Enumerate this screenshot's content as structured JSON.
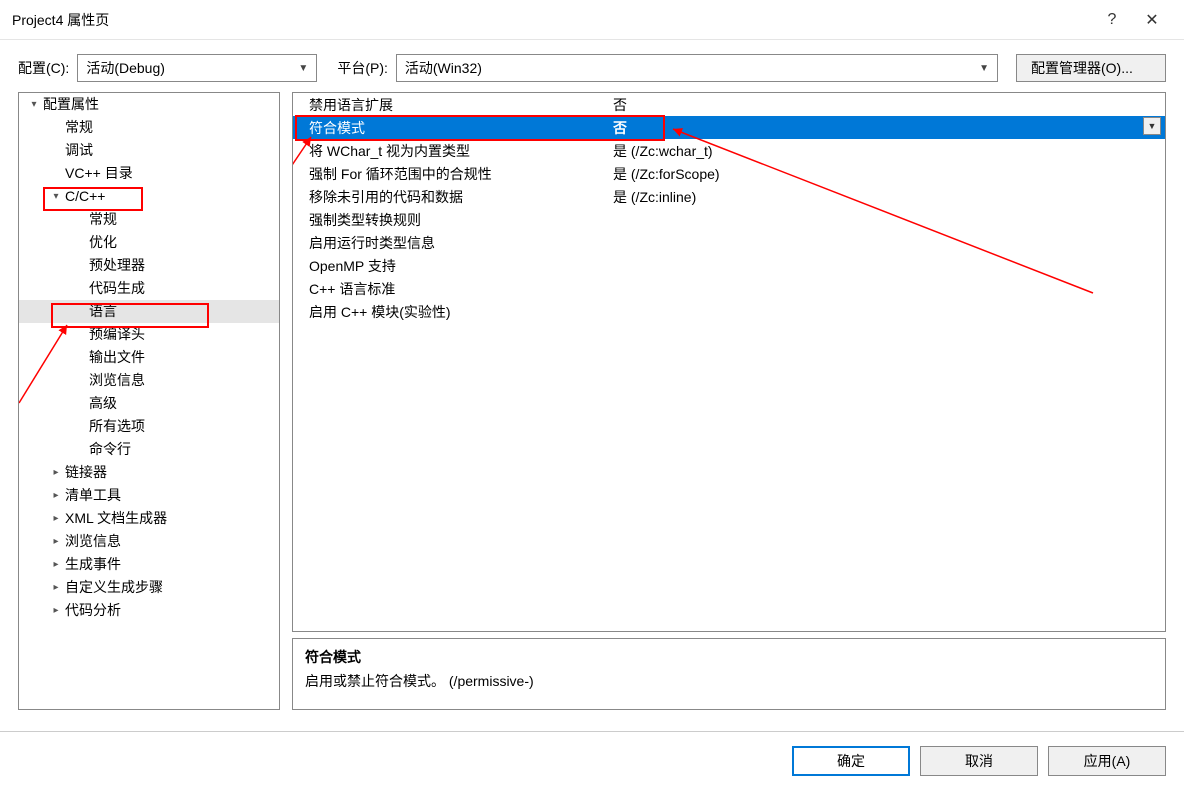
{
  "window": {
    "title": "Project4 属性页"
  },
  "toolbar": {
    "config_label": "配置(C):",
    "config_value": "活动(Debug)",
    "platform_label": "平台(P):",
    "platform_value": "活动(Win32)",
    "manager_btn": "配置管理器(O)..."
  },
  "tree": [
    {
      "lvl": 0,
      "exp": "▾",
      "label": "配置属性"
    },
    {
      "lvl": 1,
      "exp": "",
      "label": "常规"
    },
    {
      "lvl": 1,
      "exp": "",
      "label": "调试"
    },
    {
      "lvl": 1,
      "exp": "",
      "label": "VC++ 目录"
    },
    {
      "lvl": 1,
      "exp": "▾",
      "label": "C/C++",
      "hl": true
    },
    {
      "lvl": 2,
      "exp": "",
      "label": "常规"
    },
    {
      "lvl": 2,
      "exp": "",
      "label": "优化"
    },
    {
      "lvl": 2,
      "exp": "",
      "label": "预处理器"
    },
    {
      "lvl": 2,
      "exp": "",
      "label": "代码生成"
    },
    {
      "lvl": 2,
      "exp": "",
      "label": "语言",
      "sel": true,
      "hl": true
    },
    {
      "lvl": 2,
      "exp": "",
      "label": "预编译头"
    },
    {
      "lvl": 2,
      "exp": "",
      "label": "输出文件"
    },
    {
      "lvl": 2,
      "exp": "",
      "label": "浏览信息"
    },
    {
      "lvl": 2,
      "exp": "",
      "label": "高级"
    },
    {
      "lvl": 2,
      "exp": "",
      "label": "所有选项"
    },
    {
      "lvl": 2,
      "exp": "",
      "label": "命令行"
    },
    {
      "lvl": 1,
      "exp": "▸",
      "label": "链接器"
    },
    {
      "lvl": 1,
      "exp": "▸",
      "label": "清单工具"
    },
    {
      "lvl": 1,
      "exp": "▸",
      "label": "XML 文档生成器"
    },
    {
      "lvl": 1,
      "exp": "▸",
      "label": "浏览信息"
    },
    {
      "lvl": 1,
      "exp": "▸",
      "label": "生成事件"
    },
    {
      "lvl": 1,
      "exp": "▸",
      "label": "自定义生成步骤"
    },
    {
      "lvl": 1,
      "exp": "▸",
      "label": "代码分析"
    }
  ],
  "grid": [
    {
      "name": "禁用语言扩展",
      "value": "否"
    },
    {
      "name": "符合模式",
      "value": "否",
      "sel": true,
      "dd": true
    },
    {
      "name": "将 WChar_t 视为内置类型",
      "value": "是 (/Zc:wchar_t)"
    },
    {
      "name": "强制 For 循环范围中的合规性",
      "value": "是 (/Zc:forScope)"
    },
    {
      "name": "移除未引用的代码和数据",
      "value": "是 (/Zc:inline)"
    },
    {
      "name": "强制类型转换规则",
      "value": ""
    },
    {
      "name": "启用运行时类型信息",
      "value": ""
    },
    {
      "name": "OpenMP 支持",
      "value": ""
    },
    {
      "name": "C++ 语言标准",
      "value": ""
    },
    {
      "name": "启用 C++ 模块(实验性)",
      "value": ""
    }
  ],
  "desc": {
    "title": "符合模式",
    "body": "启用或禁止符合模式。     (/permissive-)"
  },
  "footer": {
    "ok": "确定",
    "cancel": "取消",
    "apply": "应用(A)"
  }
}
